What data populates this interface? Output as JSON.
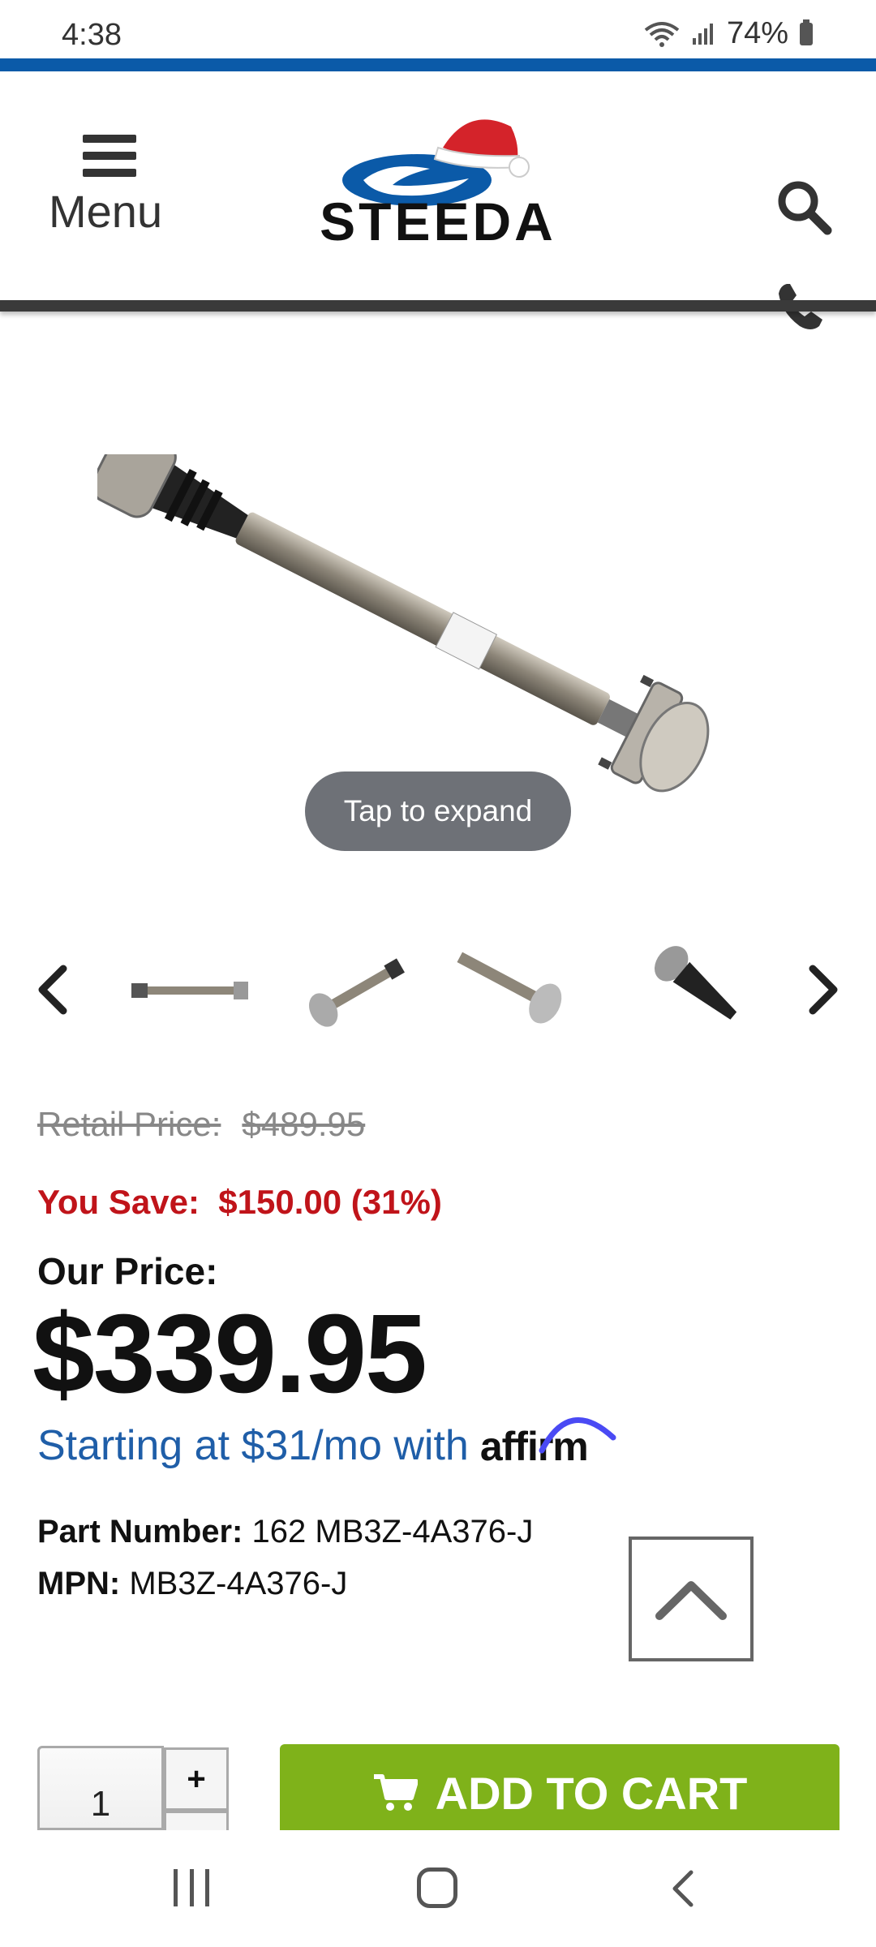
{
  "status_bar": {
    "time": "4:38",
    "battery": "74%"
  },
  "header": {
    "menu_label": "Menu",
    "brand": "STEEDA"
  },
  "gallery": {
    "tap_hint": "Tap to expand"
  },
  "pricing": {
    "retail_label": "Retail Price:",
    "retail_value": "$489.95",
    "save_label": "You Save:",
    "save_value": "$150.00 (31%)",
    "our_price_label": "Our Price:",
    "our_price_value": "$339.95",
    "financing_text": "Starting at $31/mo with",
    "financing_brand": "affirm"
  },
  "details": {
    "part_number_label": "Part Number:",
    "part_number_value": "162 MB3Z-4A376-J",
    "mpn_label": "MPN:",
    "mpn_value": "MB3Z-4A376-J"
  },
  "cart": {
    "quantity": "1",
    "plus_label": "+",
    "button_label": "ADD TO CART"
  },
  "colors": {
    "brand_blue": "#0b5aa8",
    "sale_red": "#c0141a",
    "cart_green": "#7fb21a",
    "affirm_blue": "#1f5ea8"
  }
}
